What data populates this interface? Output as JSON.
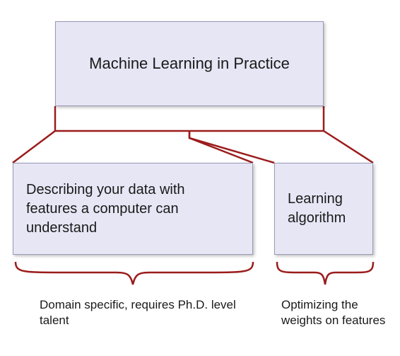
{
  "diagram": {
    "title": "Machine Learning in Practice",
    "left_box": "Describing your data with features a computer can understand",
    "right_box": "Learning algorithm",
    "caption_left": "Domain specific, requires Ph.D. level talent",
    "caption_right": "Optimizing the weights on features"
  },
  "colors": {
    "box_fill": "#e6e6f5",
    "box_border": "#9999b8",
    "connector": "#9b1c1c"
  }
}
